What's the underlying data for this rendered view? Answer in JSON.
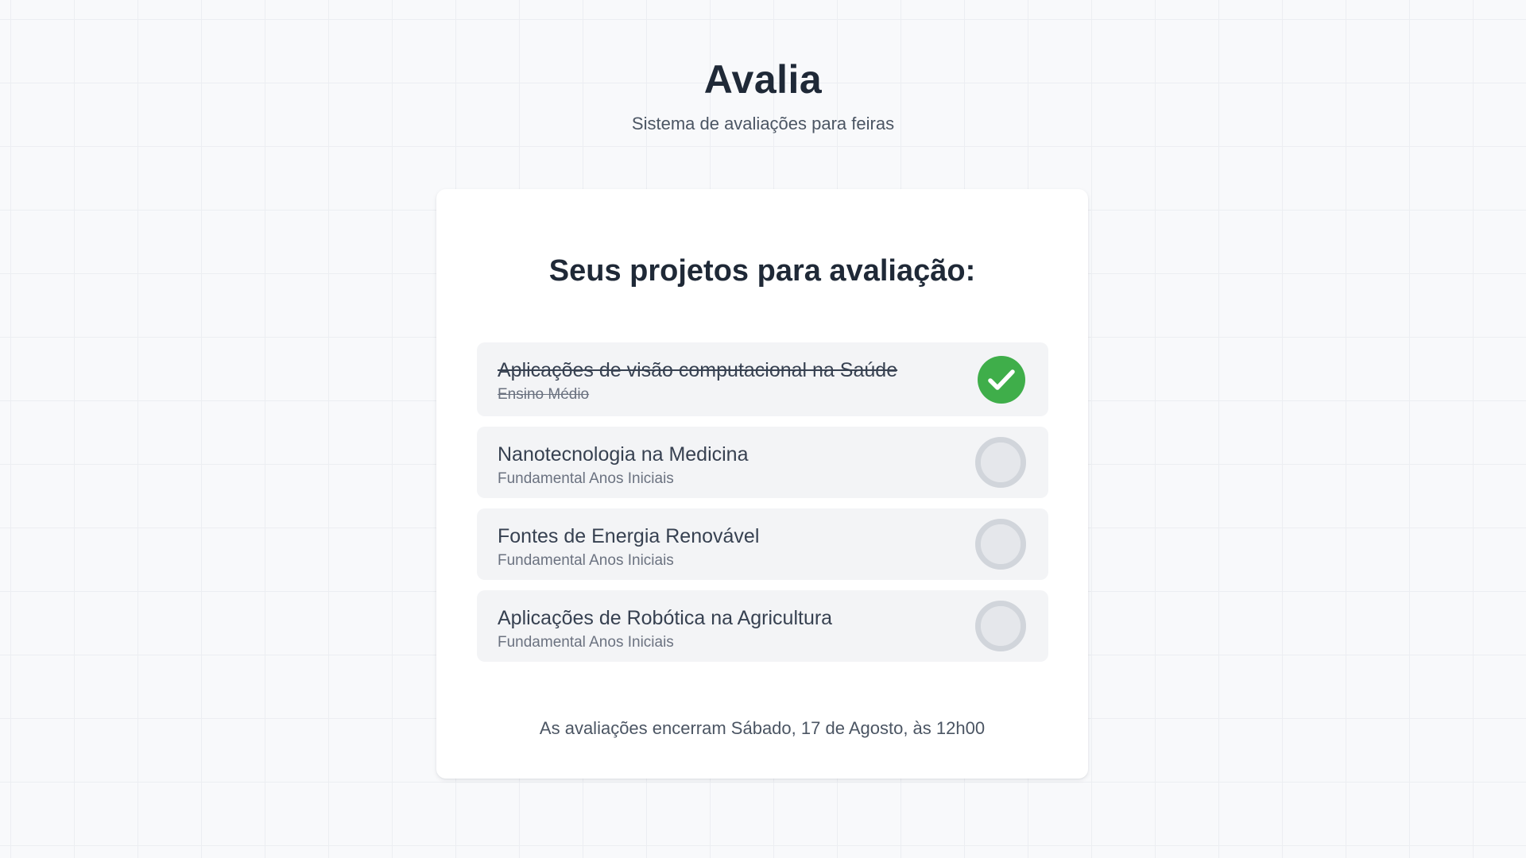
{
  "app": {
    "title": "Avalia",
    "subtitle": "Sistema de avaliações para feiras"
  },
  "card": {
    "title": "Seus projetos para avaliação:",
    "deadline": "As avaliações encerram Sábado, 17 de Agosto, às 12h00"
  },
  "projects": [
    {
      "name": "Aplicações de visão computacional na Saúde",
      "level": "Ensino Médio",
      "status": "evaluated",
      "icon": "check-icon"
    },
    {
      "name": "Nanotecnologia na Medicina",
      "level": "Fundamental Anos Iniciais",
      "status": "pending",
      "icon": "empty-circle-icon"
    },
    {
      "name": "Fontes de Energia Renovável",
      "level": "Fundamental Anos Iniciais",
      "status": "pending",
      "icon": "empty-circle-icon"
    },
    {
      "name": "Aplicações de Robótica na Agricultura",
      "level": "Fundamental Anos Iniciais",
      "status": "pending",
      "icon": "empty-circle-icon"
    }
  ],
  "colors": {
    "accent_success": "#3fae4a",
    "background": "#f8f9fb",
    "card": "#ffffff",
    "item": "#f3f4f6",
    "text_primary": "#1f2937",
    "text_secondary": "#6b7280"
  }
}
